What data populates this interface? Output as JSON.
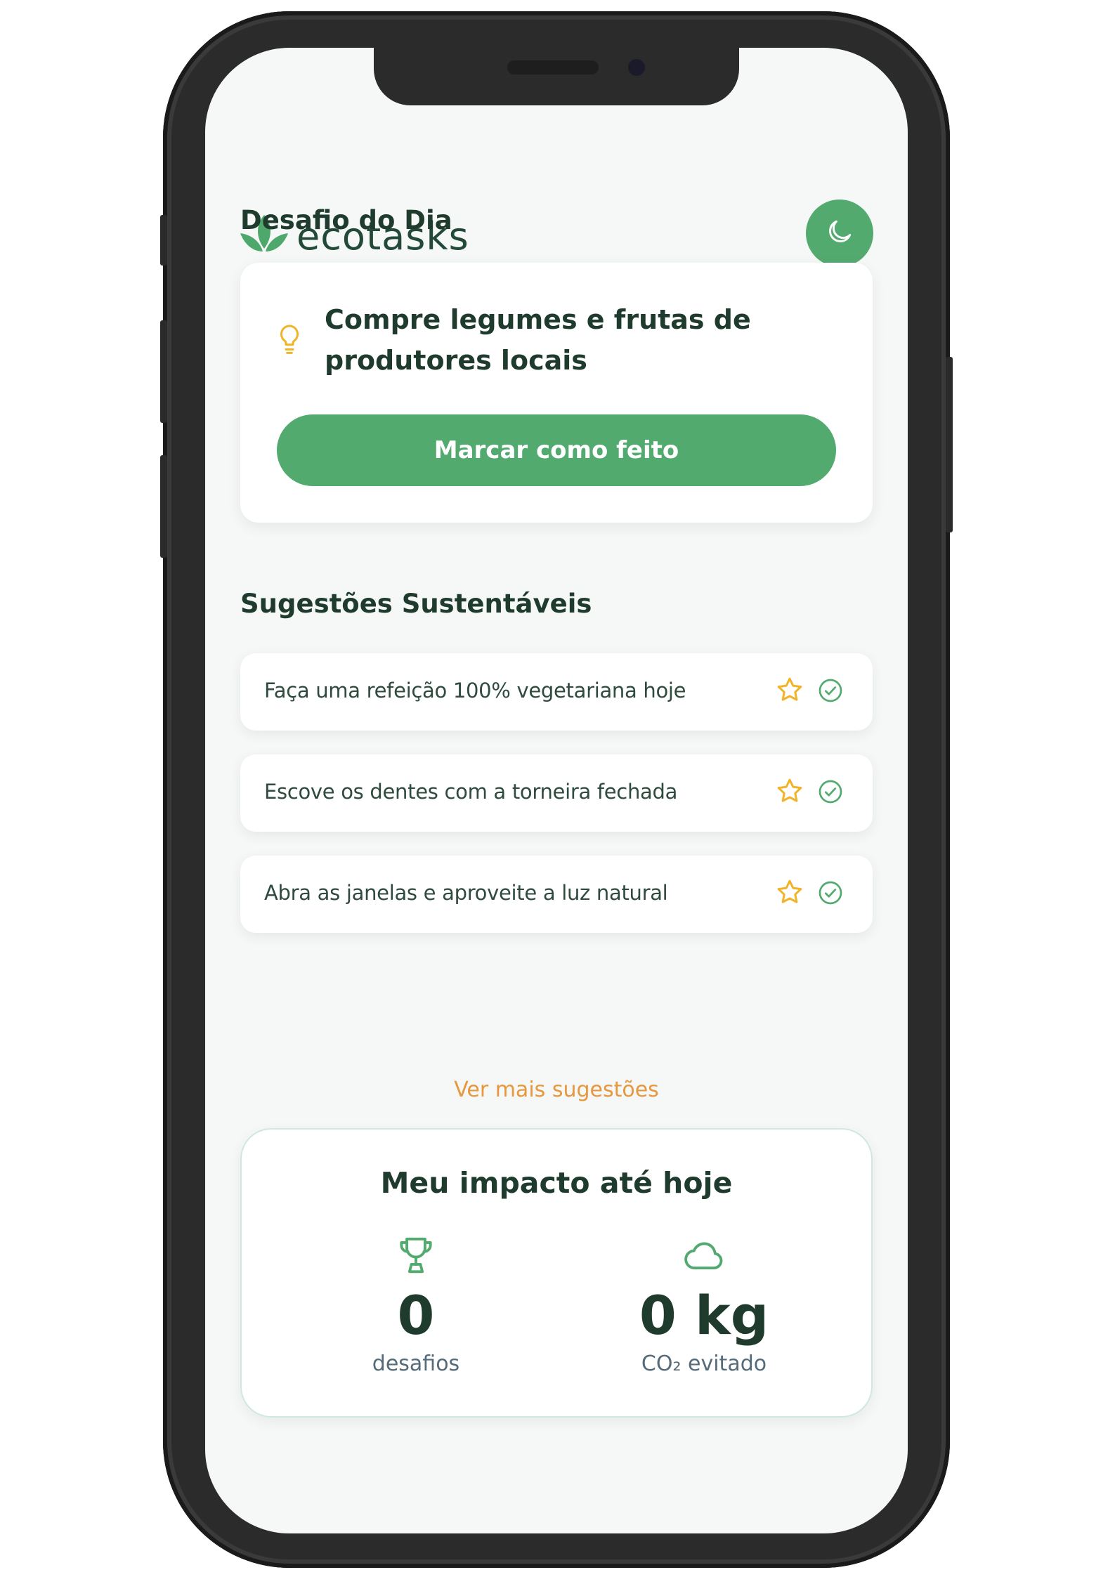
{
  "app": {
    "name": "ecotasks"
  },
  "theme_toggle": {
    "icon": "moon-icon"
  },
  "daily_challenge": {
    "section_title": "Desafio do Dia",
    "icon": "lightbulb-icon",
    "text": "Compre legumes e frutas de produtores locais",
    "button_label": "Marcar como feito"
  },
  "suggestions": {
    "section_title": "Sugestões Sustentáveis",
    "items": [
      {
        "text": "Faça uma refeição 100% vegetariana hoje"
      },
      {
        "text": "Escove os dentes com a torneira fechada"
      },
      {
        "text": "Abra as janelas e aproveite a luz natural"
      }
    ],
    "more_link": "Ver mais sugestões"
  },
  "impact": {
    "title": "Meu impacto até hoje",
    "challenges": {
      "value": "0",
      "label": "desafios",
      "icon": "trophy-icon"
    },
    "co2": {
      "value": "0 kg",
      "label": "CO₂ evitado",
      "icon": "cloud-icon"
    }
  },
  "colors": {
    "accent": "#53aa6f",
    "text_dark": "#1f3b2e",
    "star": "#f0b429",
    "link": "#e8973d",
    "background": "#f5f8f7"
  }
}
